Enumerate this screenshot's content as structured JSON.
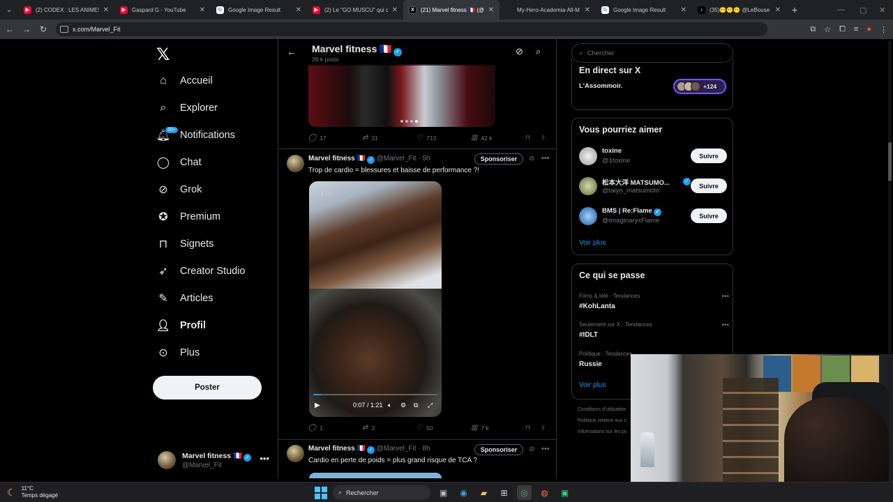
{
  "browser": {
    "tabs": [
      {
        "title": "(2) CODEX : LES ANIMES",
        "icon": "youtube-icon",
        "color": "#ff0033"
      },
      {
        "title": "Gaspard G - YouTube",
        "icon": "youtube-icon",
        "color": "#ff0033"
      },
      {
        "title": "Google Image Result",
        "icon": "google-icon",
        "color": "#4285f4"
      },
      {
        "title": "(2) Le \"GO MUSCU\" qui ce",
        "icon": "youtube-icon",
        "color": "#ff0033"
      },
      {
        "title": "(21) Marvel fitness 🇫🇷 (@M",
        "icon": "x-icon",
        "color": "#000000"
      },
      {
        "title": "My-Hero-Academia-All-M",
        "icon": "page-icon",
        "color": "#5f6368"
      },
      {
        "title": "Google Image Result",
        "icon": "google-icon",
        "color": "#4285f4"
      },
      {
        "title": "(35)😶😶😶 @LeBouse",
        "icon": "tiktok-icon",
        "color": "#000000"
      }
    ],
    "active_tab": 4,
    "url": "x.com/Marvel_Fit"
  },
  "nav": {
    "items": [
      {
        "label": "Accueil",
        "icon": "home-icon"
      },
      {
        "label": "Explorer",
        "icon": "search-icon"
      },
      {
        "label": "Notifications",
        "icon": "bell-icon",
        "badge": "20+"
      },
      {
        "label": "Chat",
        "icon": "chat-icon"
      },
      {
        "label": "Grok",
        "icon": "grok-icon"
      },
      {
        "label": "Premium",
        "icon": "premium-icon"
      },
      {
        "label": "Signets",
        "icon": "bookmark-icon"
      },
      {
        "label": "Creator Studio",
        "icon": "rocket-icon"
      },
      {
        "label": "Articles",
        "icon": "article-icon"
      },
      {
        "label": "Profil",
        "icon": "profile-icon"
      },
      {
        "label": "Plus",
        "icon": "more-circle-icon"
      }
    ],
    "post_button": "Poster",
    "account": {
      "name": "Marvel fitness 🇫🇷",
      "handle": "@Marvel_Fit"
    }
  },
  "profile_header": {
    "name": "Marvel fitness 🇫🇷",
    "posts_count": "38 k posts"
  },
  "posts": [
    {
      "replies": "17",
      "reposts": "31",
      "likes": "713",
      "views": "42 k"
    },
    {
      "author": "Marvel fitness 🇫🇷",
      "handle": "@Marvel_Fit",
      "time": "· 5h",
      "sponsor_label": "Sponsoriser",
      "text": "Trop de cardio = blessures et baisse de performance ?!",
      "video": {
        "speed": "1.00",
        "time": "0:07 / 1:21",
        "progress": 0.06
      },
      "replies": "1",
      "reposts": "3",
      "likes": "50",
      "views": "7 k"
    },
    {
      "author": "Marvel fitness 🇫🇷",
      "handle": "@Marvel_Fit",
      "time": "· 8h",
      "sponsor_label": "Sponsoriser",
      "text": "Cardio en perte de poids = plus  grand risque de TCA ?"
    }
  ],
  "right": {
    "search_placeholder": "Chercher",
    "live": {
      "title": "En direct sur X",
      "space": "L'Assommoir.",
      "count": "+124"
    },
    "suggestions": {
      "title": "Vous pourriez aimer",
      "users": [
        {
          "name": "toxine",
          "handle": "@1toxine",
          "verified": false,
          "follow": "Suivre"
        },
        {
          "name": "松本大洋 MATSUMO...",
          "handle": "@taiyo_matsumoto",
          "verified": true,
          "follow": "Suivre"
        },
        {
          "name": "BMS | Re:Flame",
          "handle": "@ImaginaryxFlame",
          "verified": true,
          "follow": "Suivre"
        }
      ],
      "more": "Voir plus"
    },
    "trends": {
      "title": "Ce qui se passe",
      "items": [
        {
          "context": "Films & télé · Tendances",
          "name": "#KohLanta"
        },
        {
          "context": "Seulement sur X · Tendances",
          "name": "#IDLT"
        },
        {
          "context": "Politique · Tendances",
          "name": "Russie"
        }
      ],
      "more": "Voir plus"
    },
    "footer": [
      "Conditions d'utilisation",
      "Politique relative aux c",
      "Informations sur les pu"
    ]
  },
  "taskbar": {
    "temp": "11°C",
    "weather": "Temps dégagé",
    "search": "Rechercher"
  }
}
